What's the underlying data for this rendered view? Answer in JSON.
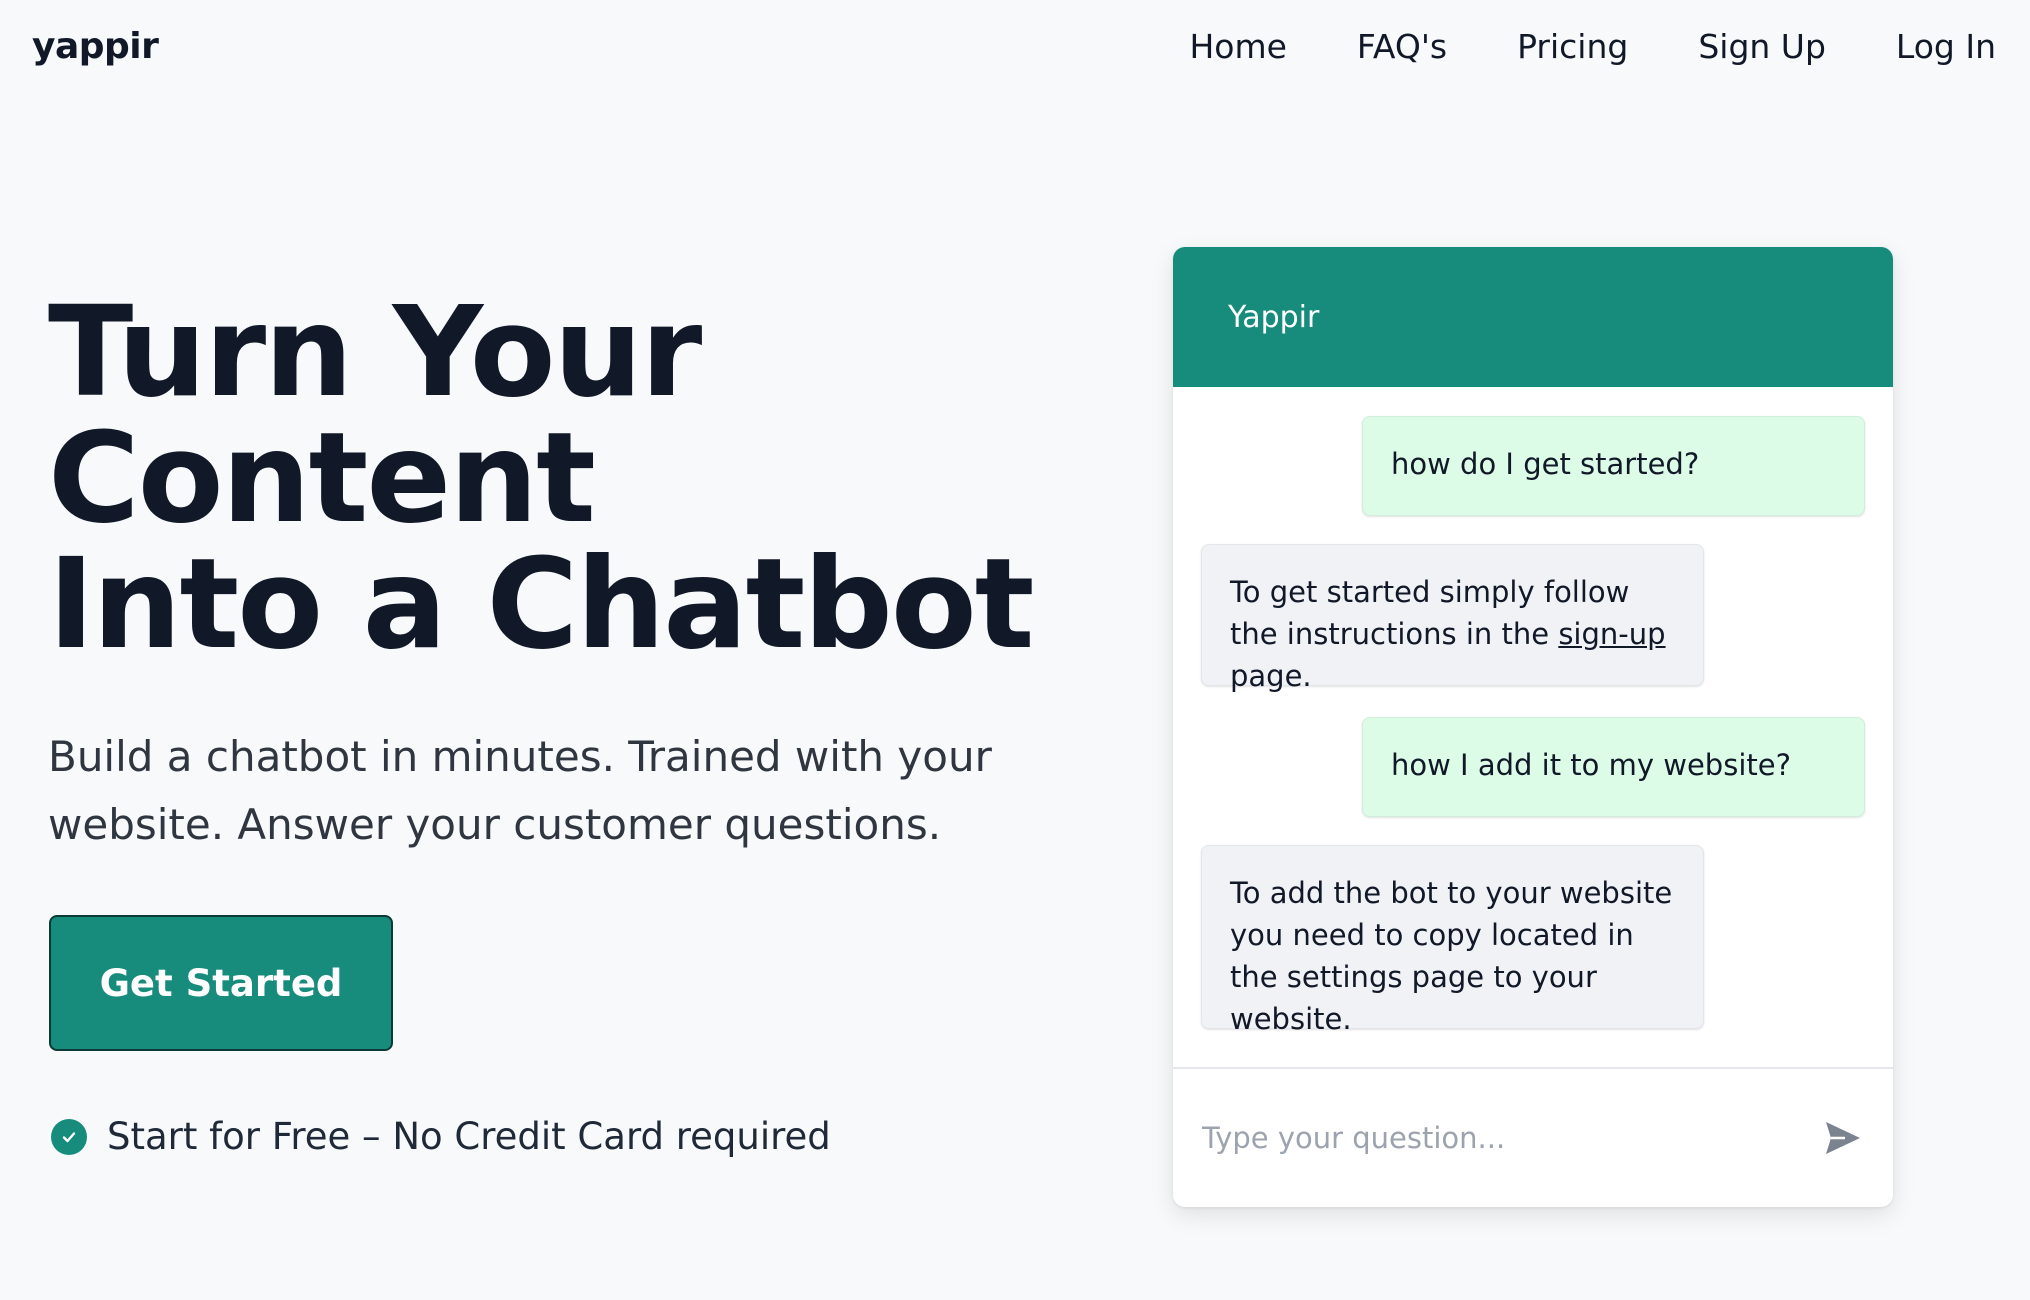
{
  "header": {
    "brand": "yappir",
    "nav": [
      "Home",
      "FAQ's",
      "Pricing",
      "Sign Up",
      "Log In"
    ]
  },
  "hero": {
    "title_lines": [
      "Turn Your",
      "Content",
      "Into a Chatbot"
    ],
    "subtitle": "Build a chatbot in minutes. Trained with your website. Answer your customer questions.",
    "cta_label": "Get Started",
    "note": "Start for Free – No Credit Card required"
  },
  "chat": {
    "title": "Yappir",
    "messages": [
      {
        "role": "user",
        "text": "how do I get started?"
      },
      {
        "role": "bot",
        "text_before": "To get started simply follow the instructions in the ",
        "link": "sign-up",
        "text_after": " page."
      },
      {
        "role": "user",
        "text": "how I add it to my website?"
      },
      {
        "role": "bot",
        "text": "To add the bot to your website you need to copy located in the settings page to your website."
      }
    ],
    "input_placeholder": "Type your question..."
  },
  "colors": {
    "accent": "#178b7c",
    "user_bubble": "#dcfce7",
    "bot_bubble": "#f0f2f6",
    "background": "#f7f9fb"
  },
  "icons": {
    "note": "check-circle-icon",
    "send": "send-icon"
  }
}
